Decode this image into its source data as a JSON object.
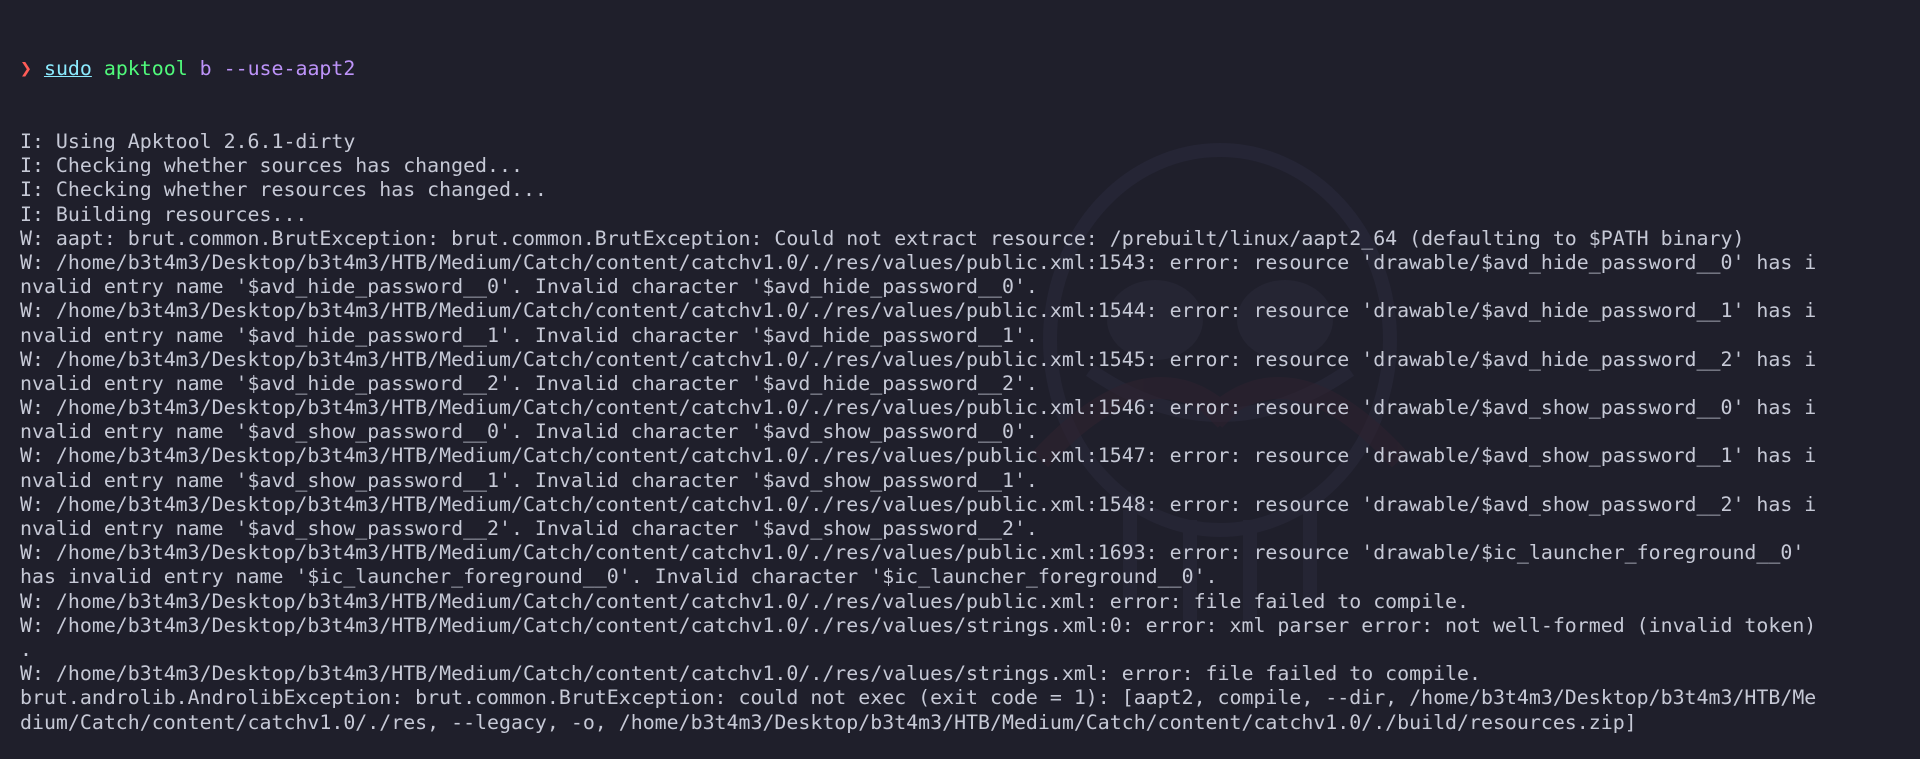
{
  "colors": {
    "background": "#1f1f2b",
    "text": "#c6c9d6",
    "prompt": "#ff5c57",
    "sudo": "#8be9fd",
    "command": "#50fa7b",
    "args": "#bd93f9"
  },
  "prompt": {
    "glyph": "❯",
    "sudo": "sudo",
    "command": "apktool",
    "args": "b --use-aapt2"
  },
  "output_lines": [
    "I: Using Apktool 2.6.1-dirty",
    "I: Checking whether sources has changed...",
    "I: Checking whether resources has changed...",
    "I: Building resources...",
    "W: aapt: brut.common.BrutException: brut.common.BrutException: Could not extract resource: /prebuilt/linux/aapt2_64 (defaulting to $PATH binary)",
    "W: /home/b3t4m3/Desktop/b3t4m3/HTB/Medium/Catch/content/catchv1.0/./res/values/public.xml:1543: error: resource 'drawable/$avd_hide_password__0' has i",
    "nvalid entry name '$avd_hide_password__0'. Invalid character '$avd_hide_password__0'.",
    "W: /home/b3t4m3/Desktop/b3t4m3/HTB/Medium/Catch/content/catchv1.0/./res/values/public.xml:1544: error: resource 'drawable/$avd_hide_password__1' has i",
    "nvalid entry name '$avd_hide_password__1'. Invalid character '$avd_hide_password__1'.",
    "W: /home/b3t4m3/Desktop/b3t4m3/HTB/Medium/Catch/content/catchv1.0/./res/values/public.xml:1545: error: resource 'drawable/$avd_hide_password__2' has i",
    "nvalid entry name '$avd_hide_password__2'. Invalid character '$avd_hide_password__2'.",
    "W: /home/b3t4m3/Desktop/b3t4m3/HTB/Medium/Catch/content/catchv1.0/./res/values/public.xml:1546: error: resource 'drawable/$avd_show_password__0' has i",
    "nvalid entry name '$avd_show_password__0'. Invalid character '$avd_show_password__0'.",
    "W: /home/b3t4m3/Desktop/b3t4m3/HTB/Medium/Catch/content/catchv1.0/./res/values/public.xml:1547: error: resource 'drawable/$avd_show_password__1' has i",
    "nvalid entry name '$avd_show_password__1'. Invalid character '$avd_show_password__1'.",
    "W: /home/b3t4m3/Desktop/b3t4m3/HTB/Medium/Catch/content/catchv1.0/./res/values/public.xml:1548: error: resource 'drawable/$avd_show_password__2' has i",
    "nvalid entry name '$avd_show_password__2'. Invalid character '$avd_show_password__2'.",
    "W: /home/b3t4m3/Desktop/b3t4m3/HTB/Medium/Catch/content/catchv1.0/./res/values/public.xml:1693: error: resource 'drawable/$ic_launcher_foreground__0'",
    "has invalid entry name '$ic_launcher_foreground__0'. Invalid character '$ic_launcher_foreground__0'.",
    "W: /home/b3t4m3/Desktop/b3t4m3/HTB/Medium/Catch/content/catchv1.0/./res/values/public.xml: error: file failed to compile.",
    "W: /home/b3t4m3/Desktop/b3t4m3/HTB/Medium/Catch/content/catchv1.0/./res/values/strings.xml:0: error: xml parser error: not well-formed (invalid token)",
    ".",
    "W: /home/b3t4m3/Desktop/b3t4m3/HTB/Medium/Catch/content/catchv1.0/./res/values/strings.xml: error: file failed to compile.",
    "brut.androlib.AndrolibException: brut.common.BrutException: could not exec (exit code = 1): [aapt2, compile, --dir, /home/b3t4m3/Desktop/b3t4m3/HTB/Me",
    "dium/Catch/content/catchv1.0/./res, --legacy, -o, /home/b3t4m3/Desktop/b3t4m3/HTB/Medium/Catch/content/catchv1.0/./build/resources.zip]"
  ]
}
